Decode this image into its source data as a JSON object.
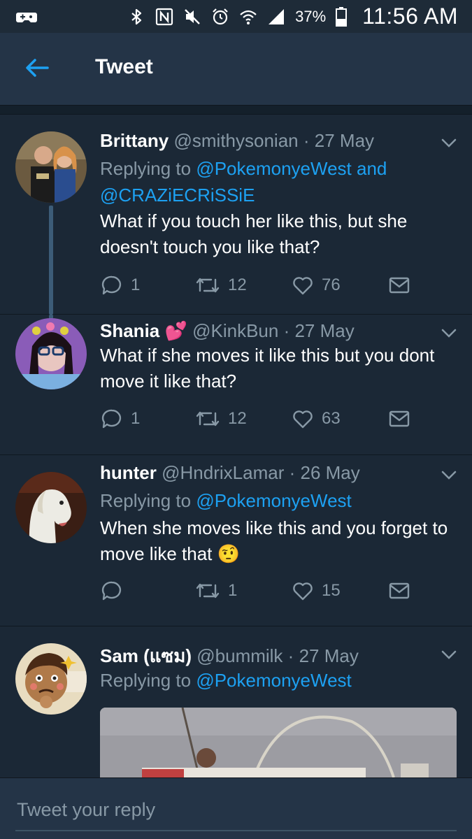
{
  "status_bar": {
    "battery_percent": "37%",
    "time": "11:56 AM",
    "icons": [
      "gamepad-icon",
      "bluetooth-icon",
      "nfc-icon",
      "mute-icon",
      "alarm-icon",
      "wifi-icon",
      "signal-icon",
      "battery-icon"
    ]
  },
  "header": {
    "title": "Tweet",
    "back_icon": "arrow-left-icon"
  },
  "tweets": [
    {
      "name": "Brittany",
      "handle": "@smithysonian",
      "dot": "·",
      "date": "27 May",
      "reply_prefix": "Replying to ",
      "mention_1": "@PokemonyeWest",
      "reply_and": " and",
      "mention_2": "@CRAZiECRiSSiE",
      "text": "What if you touch her like this, but she doesn't touch you like that?",
      "replies": "1",
      "retweets": "12",
      "likes": "76"
    },
    {
      "name": "Shania",
      "name_emoji": "💕",
      "handle": "@KinkBun",
      "dot": "·",
      "date": "27 May",
      "text": "What if she moves it like this but you dont move it like that?",
      "replies": "1",
      "retweets": "12",
      "likes": "63"
    },
    {
      "name": "hunter",
      "handle": "@HndrixLamar",
      "dot": "·",
      "date": "26 May",
      "reply_prefix": "Replying to ",
      "mention_1": "@PokemonyeWest",
      "text": "When she moves like this and you forget to move like that",
      "text_emoji": "🤨",
      "replies": "",
      "retweets": "1",
      "likes": "15"
    },
    {
      "name": "Sam (แซม)",
      "handle": "@bummilk",
      "dot": "·",
      "date": "27 May",
      "reply_prefix": "Replying to ",
      "mention_1": "@PokemonyeWest"
    }
  ],
  "reply_bar": {
    "placeholder": "Tweet your reply"
  },
  "colors": {
    "background": "#14202b",
    "card": "#1b2836",
    "header": "#243447",
    "accent": "#1da1f2",
    "muted": "#8899a6",
    "thread_line": "#3c5c78"
  }
}
